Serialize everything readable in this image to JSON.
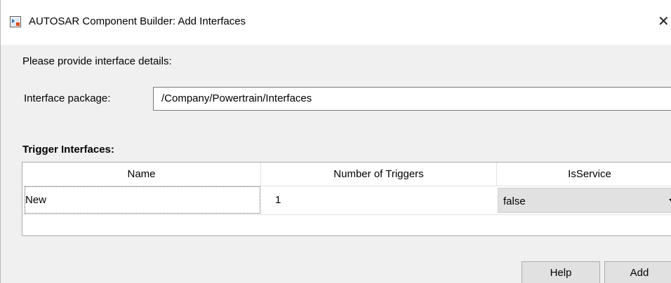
{
  "window": {
    "title": "AUTOSAR Component Builder: Add Interfaces",
    "close_glyph": "✕",
    "icon": "matlab-app-icon"
  },
  "form": {
    "instructions": "Please provide interface details:",
    "package_label": "Interface package:",
    "package_value": "/Company/Powertrain/Interfaces"
  },
  "table": {
    "section_title": "Trigger Interfaces:",
    "columns": [
      "Name",
      "Number of Triggers",
      "IsService"
    ],
    "rows": [
      {
        "name": "New",
        "num_triggers": "1",
        "is_service": "false"
      }
    ]
  },
  "buttons": {
    "help": "Help",
    "add": "Add"
  }
}
